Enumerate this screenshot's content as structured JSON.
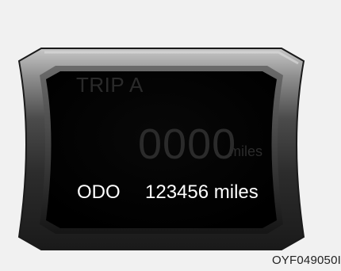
{
  "display": {
    "trip_label": "TRIP A",
    "trip_value": "0000",
    "trip_unit": "miles",
    "odo_label": "ODO",
    "odo_value": "123456 miles"
  },
  "figure": {
    "code": "OYF049050I"
  },
  "colors": {
    "background": "#f1f1f1",
    "screen": "#050505",
    "bezel_outer": "#2d2d2d",
    "bezel_highlight": "#b8b8b8",
    "inactive_text": "#2b2b2b",
    "active_text": "#ffffff",
    "caption": "#222222"
  }
}
